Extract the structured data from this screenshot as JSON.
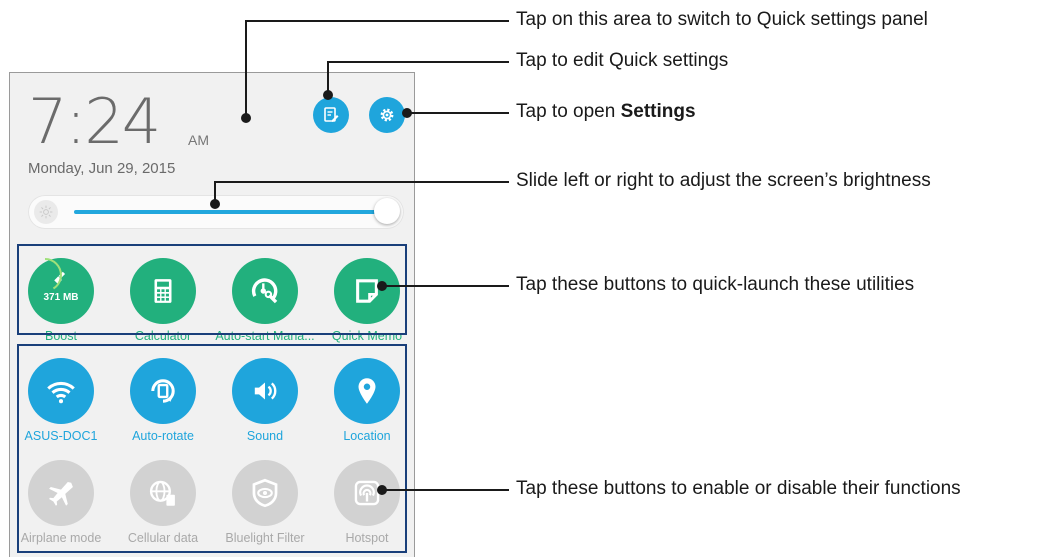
{
  "phone": {
    "time": "7:24",
    "ampm": "AM",
    "date": "Monday, Jun 29, 2015"
  },
  "brightness": {
    "level_fraction": 0.97
  },
  "utilities": [
    {
      "label": "Boost",
      "icon": "broom-icon",
      "value": "371 MB",
      "color": "#22b07d"
    },
    {
      "label": "Calculator",
      "icon": "calculator-icon",
      "color": "#22b07d"
    },
    {
      "label": "Auto-start Mana...",
      "icon": "auto-start-icon",
      "color": "#22b07d"
    },
    {
      "label": "Quick Memo",
      "icon": "memo-icon",
      "color": "#22b07d"
    }
  ],
  "toggles_on": [
    {
      "label": "ASUS-DOC1",
      "icon": "wifi-icon",
      "color": "#1fa5dc"
    },
    {
      "label": "Auto-rotate",
      "icon": "rotate-icon",
      "color": "#1fa5dc"
    },
    {
      "label": "Sound",
      "icon": "sound-icon",
      "color": "#1fa5dc"
    },
    {
      "label": "Location",
      "icon": "location-icon",
      "color": "#1fa5dc"
    }
  ],
  "toggles_off": [
    {
      "label": "Airplane mode",
      "icon": "airplane-icon",
      "color": "#d2d2d2"
    },
    {
      "label": "Cellular data",
      "icon": "cellular-icon",
      "color": "#d2d2d2"
    },
    {
      "label": "Bluelight Filter",
      "icon": "bluelight-icon",
      "color": "#d2d2d2"
    },
    {
      "label": "Hotspot",
      "icon": "hotspot-icon",
      "color": "#d2d2d2"
    }
  ],
  "callouts": {
    "switch_panel": "Tap on this area to switch to Quick settings panel",
    "edit": "Tap to edit Quick settings",
    "settings_prefix": "Tap to open ",
    "settings_bold": "Settings",
    "brightness": "Slide left or right to adjust the screen’s brightness",
    "utilities": "Tap these buttons to quick-launch these utilities",
    "toggles": "Tap these buttons to enable or disable their functions"
  }
}
